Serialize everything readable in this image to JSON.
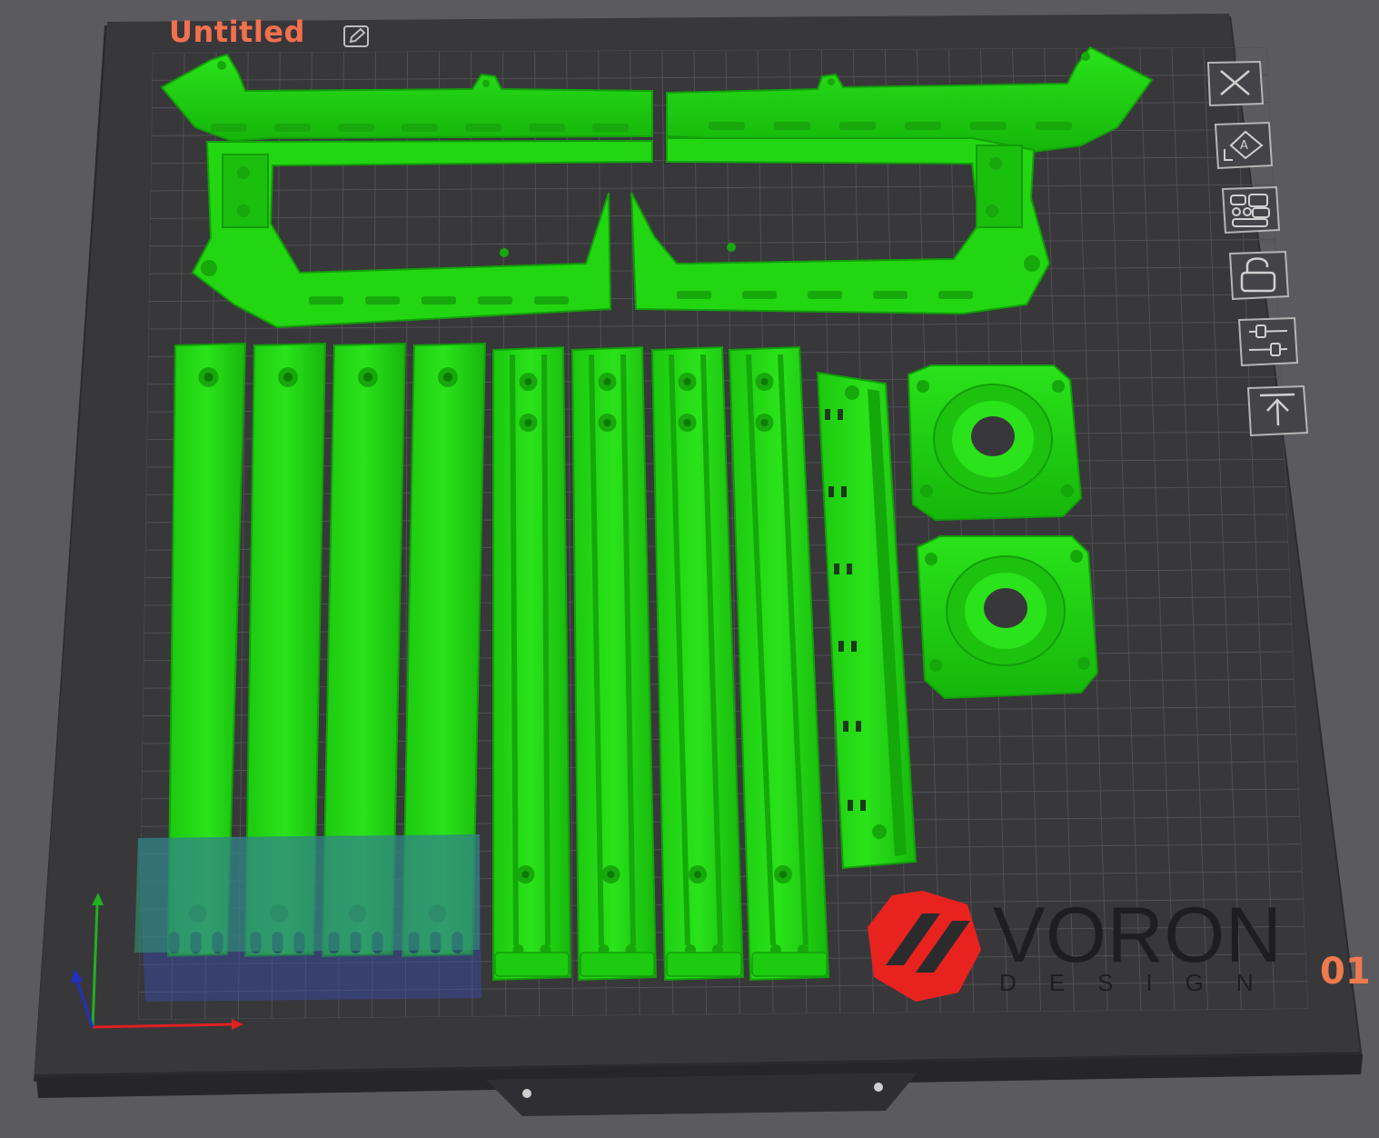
{
  "plate": {
    "title": "Untitled",
    "number": "01",
    "edit_icon": "pencil-edit-icon"
  },
  "logo": {
    "brand": "VORON",
    "tagline": "DESIGN"
  },
  "toolbar": {
    "items": [
      {
        "icon": "close-icon",
        "name": "delete-plate-button"
      },
      {
        "icon": "auto-orient-icon",
        "name": "auto-orient-button"
      },
      {
        "icon": "arrange-icon",
        "name": "arrange-button"
      },
      {
        "icon": "lock-icon",
        "name": "lock-plate-button"
      },
      {
        "icon": "plate-settings-icon",
        "name": "plate-settings-button"
      },
      {
        "icon": "move-to-top-icon",
        "name": "move-to-top-button"
      }
    ]
  },
  "colors": {
    "background": "#5b5b5f",
    "plate": "#38383b",
    "grid": "#55555a",
    "parts": "#22dd11",
    "title_accent": "#f2704e",
    "logo_red": "#e8231f",
    "selection_box": "#3a4bb0",
    "axis_x": "#e02020",
    "axis_y": "#20b020",
    "axis_z": "#2030c0"
  }
}
